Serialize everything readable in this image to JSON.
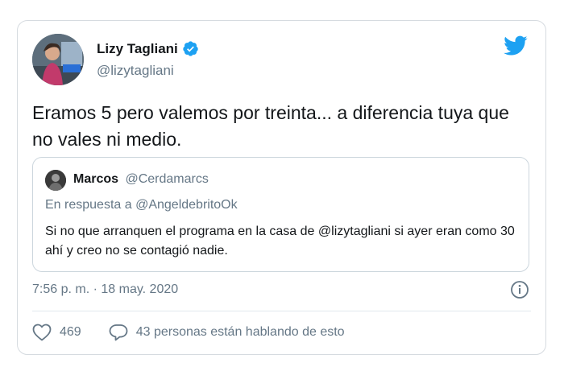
{
  "tweet": {
    "author": {
      "display_name": "Lizy Tagliani",
      "handle": "@lizytagliani",
      "verified": true
    },
    "text": "Eramos 5 pero valemos por treinta... a diferencia tuya que no vales ni medio.",
    "timestamp": "7:56 p. m. · 18 may. 2020",
    "likes": "469",
    "conversation_label": "43 personas están hablando de esto"
  },
  "quoted_tweet": {
    "display_name": "Marcos",
    "handle": "@Cerdamarcs",
    "reply_prefix": "En respuesta a ",
    "reply_to": "@AngeldebritoOk",
    "text": "Si no que arranquen el programa en la casa de @lizytagliani si ayer eran como 30 ahí y creo no se contagió nadie."
  },
  "icons": {
    "brand_logo": "twitter-bird-icon",
    "verified": "verified-badge-icon",
    "info": "info-icon",
    "like": "heart-icon",
    "reply": "speech-bubble-icon"
  },
  "colors": {
    "brand": "#1da1f2",
    "text_primary": "#14171a",
    "text_secondary": "#657786",
    "border": "#d6dbe0"
  }
}
